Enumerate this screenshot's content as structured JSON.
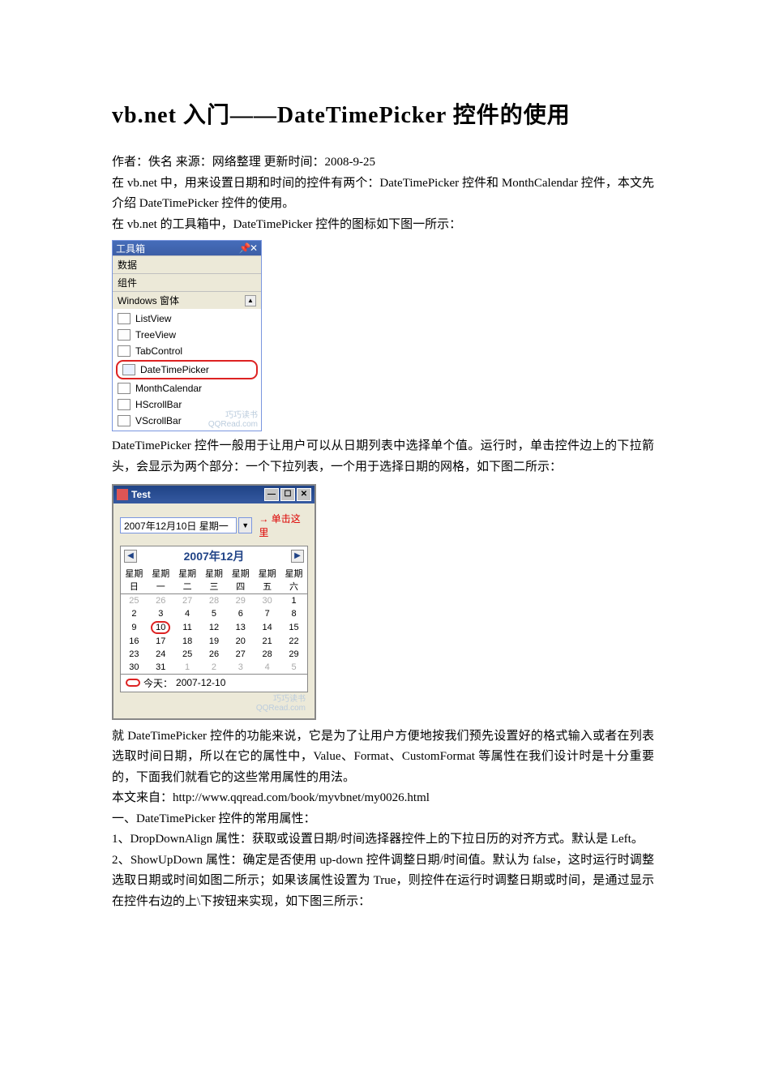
{
  "title": "vb.net 入门——DateTimePicker 控件的使用",
  "meta_line": "作者：佚名 来源：网络整理 更新时间：2008-9-25",
  "p1": "在 vb.net 中，用来设置日期和时间的控件有两个：DateTimePicker 控件和 MonthCalendar 控件，本文先介绍 DateTimePicker 控件的使用。",
  "p2": "在 vb.net 的工具箱中，DateTimePicker 控件的图标如下图一所示：",
  "toolbox": {
    "title": "工具箱",
    "pin_glyph": "📌",
    "close_glyph": "✕",
    "sections": {
      "data": "数据",
      "components": "组件",
      "winforms": "Windows 窗体"
    },
    "scroll_up_glyph": "▲",
    "items": [
      {
        "name": "ListView",
        "icon": "ic-listview"
      },
      {
        "name": "TreeView",
        "icon": "ic-treeview"
      },
      {
        "name": "TabControl",
        "icon": "ic-tab"
      },
      {
        "name": "DateTimePicker",
        "icon": "ic-dtp",
        "highlight": true
      },
      {
        "name": "MonthCalendar",
        "icon": "ic-mcal"
      },
      {
        "name": "HScrollBar",
        "icon": "ic-hscroll"
      },
      {
        "name": "VScrollBar",
        "icon": "ic-vscroll"
      }
    ],
    "watermark1": "巧巧读书",
    "watermark2": "QQRead.com"
  },
  "p3": "DateTimePicker 控件一般用于让用户可以从日期列表中选择单个值。运行时，单击控件边上的下拉箭头，会显示为两个部分：一个下拉列表，一个用于选择日期的网格，如下图二所示：",
  "window": {
    "title": "Test",
    "min_glyph": "—",
    "max_glyph": "☐",
    "close_glyph": "✕",
    "dtp_value": "2007年12月10日 星期一",
    "drop_glyph": "▼",
    "callout_arrow": "→",
    "callout_text": "单击这里",
    "month_title": "2007年12月",
    "prev_glyph": "◀",
    "next_glyph": "▶",
    "weekdays": [
      "星期日",
      "星期一",
      "星期二",
      "星期三",
      "星期四",
      "星期五",
      "星期六"
    ],
    "rows": [
      {
        "c": [
          "25",
          "26",
          "27",
          "28",
          "29",
          "30",
          "1"
        ],
        "dimTo": 5
      },
      {
        "c": [
          "2",
          "3",
          "4",
          "5",
          "6",
          "7",
          "8"
        ]
      },
      {
        "c": [
          "9",
          "10",
          "11",
          "12",
          "13",
          "14",
          "15"
        ],
        "today": 1
      },
      {
        "c": [
          "16",
          "17",
          "18",
          "19",
          "20",
          "21",
          "22"
        ]
      },
      {
        "c": [
          "23",
          "24",
          "25",
          "26",
          "27",
          "28",
          "29"
        ]
      },
      {
        "c": [
          "30",
          "31",
          "1",
          "2",
          "3",
          "4",
          "5"
        ],
        "dimFrom": 2
      }
    ],
    "today_label": "今天：",
    "today_date": "2007-12-10",
    "watermark1": "巧巧读书",
    "watermark2": "QQRead.com"
  },
  "p4": "就 DateTimePicker 控件的功能来说，它是为了让用户方便地按我们预先设置好的格式输入或者在列表选取时间日期，所以在它的属性中，Value、Format、CustomFormat 等属性在我们设计时是十分重要的，下面我们就看它的这些常用属性的用法。",
  "p5": "本文来自：http://www.qqread.com/book/myvbnet/my0026.html",
  "p6": "一、DateTimePicker 控件的常用属性：",
  "p7": "1、DropDownAlign 属性：获取或设置日期/时间选择器控件上的下拉日历的对齐方式。默认是 Left。",
  "p8": "2、ShowUpDown 属性：确定是否使用 up-down 控件调整日期/时间值。默认为 false，这时运行时调整选取日期或时间如图二所示；如果该属性设置为 True，则控件在运行时调整日期或时间，是通过显示在控件右边的上\\下按钮来实现，如下图三所示："
}
